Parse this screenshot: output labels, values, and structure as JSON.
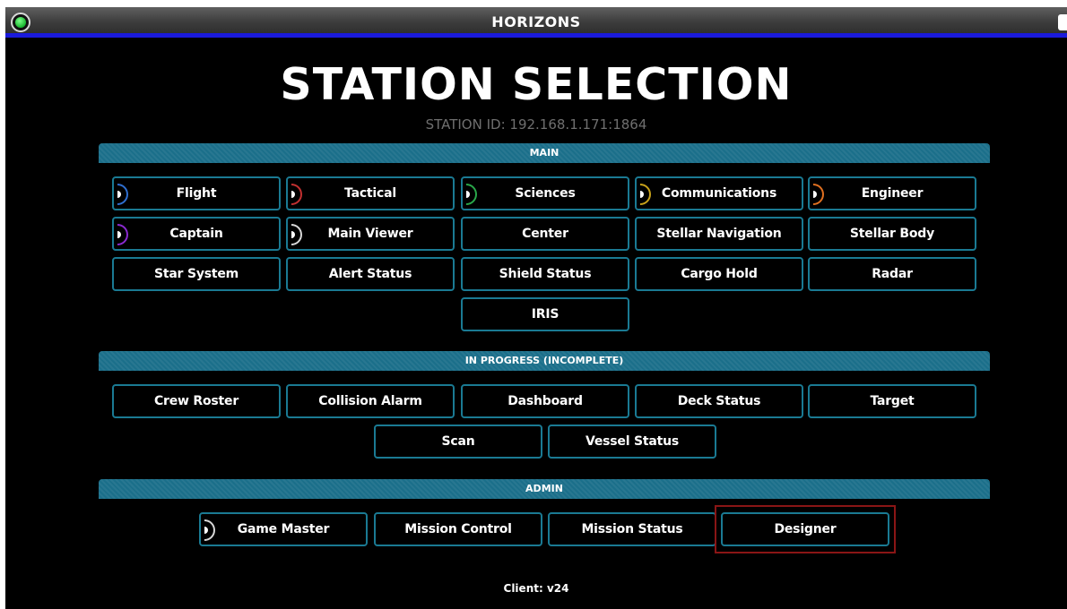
{
  "window": {
    "title": "HORIZONS"
  },
  "page": {
    "heading": "STATION SELECTION",
    "station_id": "STATION ID: 192.168.1.171:1864"
  },
  "sections": {
    "main": {
      "label": "MAIN",
      "buttons": [
        {
          "label": "Flight",
          "icon": "flight-icon",
          "icon_color": "#2f6fd0"
        },
        {
          "label": "Tactical",
          "icon": "tactical-icon",
          "icon_color": "#c23030"
        },
        {
          "label": "Sciences",
          "icon": "sciences-icon",
          "icon_color": "#2aa84a"
        },
        {
          "label": "Communications",
          "icon": "communications-icon",
          "icon_color": "#c8a21a"
        },
        {
          "label": "Engineer",
          "icon": "engineer-icon",
          "icon_color": "#e07020"
        },
        {
          "label": "Captain",
          "icon": "captain-icon",
          "icon_color": "#8a2ad0"
        },
        {
          "label": "Main Viewer",
          "icon": "main-viewer-icon",
          "icon_color": "#d8d8d8"
        },
        {
          "label": "Center"
        },
        {
          "label": "Stellar Navigation"
        },
        {
          "label": "Stellar Body"
        },
        {
          "label": "Star System"
        },
        {
          "label": "Alert Status"
        },
        {
          "label": "Shield Status"
        },
        {
          "label": "Cargo Hold"
        },
        {
          "label": "Radar"
        },
        {
          "label": "IRIS"
        }
      ]
    },
    "in_progress": {
      "label": "IN PROGRESS (INCOMPLETE)",
      "buttons": [
        {
          "label": "Crew Roster"
        },
        {
          "label": "Collision Alarm"
        },
        {
          "label": "Dashboard"
        },
        {
          "label": "Deck Status"
        },
        {
          "label": "Target"
        },
        {
          "label": "Scan"
        },
        {
          "label": "Vessel Status"
        }
      ]
    },
    "admin": {
      "label": "ADMIN",
      "buttons": [
        {
          "label": "Game Master",
          "icon": "game-master-icon",
          "icon_color": "#d8d8d8"
        },
        {
          "label": "Mission Control"
        },
        {
          "label": "Mission Status"
        },
        {
          "label": "Designer"
        }
      ]
    }
  },
  "footer": {
    "client_version": "Client: v24"
  },
  "colors": {
    "accent": "#1b6f8a",
    "button_border": "#1a7a93",
    "titlebar_stripe": "#1a1adc",
    "highlight": "#8a1515"
  }
}
